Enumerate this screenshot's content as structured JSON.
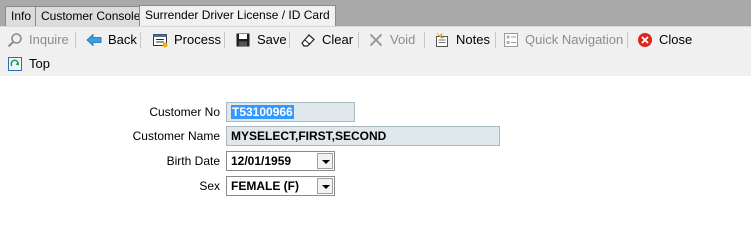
{
  "tabs": [
    {
      "label": "Info"
    },
    {
      "label": "Customer Console"
    },
    {
      "label": "Surrender Driver License / ID Card"
    }
  ],
  "toolbar": {
    "inquire": "Inquire",
    "back": "Back",
    "process": "Process",
    "save": "Save",
    "clear": "Clear",
    "void": "Void",
    "notes": "Notes",
    "quick_navigation": "Quick Navigation",
    "close": "Close",
    "top": "Top"
  },
  "form": {
    "customer_no": {
      "label": "Customer No",
      "value": "T53100966"
    },
    "customer_name": {
      "label": "Customer Name",
      "value": "MYSELECT,FIRST,SECOND"
    },
    "birth_date": {
      "label": "Birth Date",
      "value": "12/01/1959"
    },
    "sex": {
      "label": "Sex",
      "value": "FEMALE (F)"
    }
  },
  "colors": {
    "tab_strip": "#a9a9a9",
    "toolbar_bg": "#f0f0f0",
    "field_bg": "#dfe8ea",
    "selection_highlight": "#3399ff",
    "close_icon_red": "#d9271e"
  },
  "icons": [
    "search-icon",
    "back-arrow-icon",
    "process-icon",
    "save-disk-icon",
    "eraser-icon",
    "void-x-icon",
    "notes-icon",
    "quick-navigation-icon",
    "close-icon",
    "top-icon"
  ]
}
